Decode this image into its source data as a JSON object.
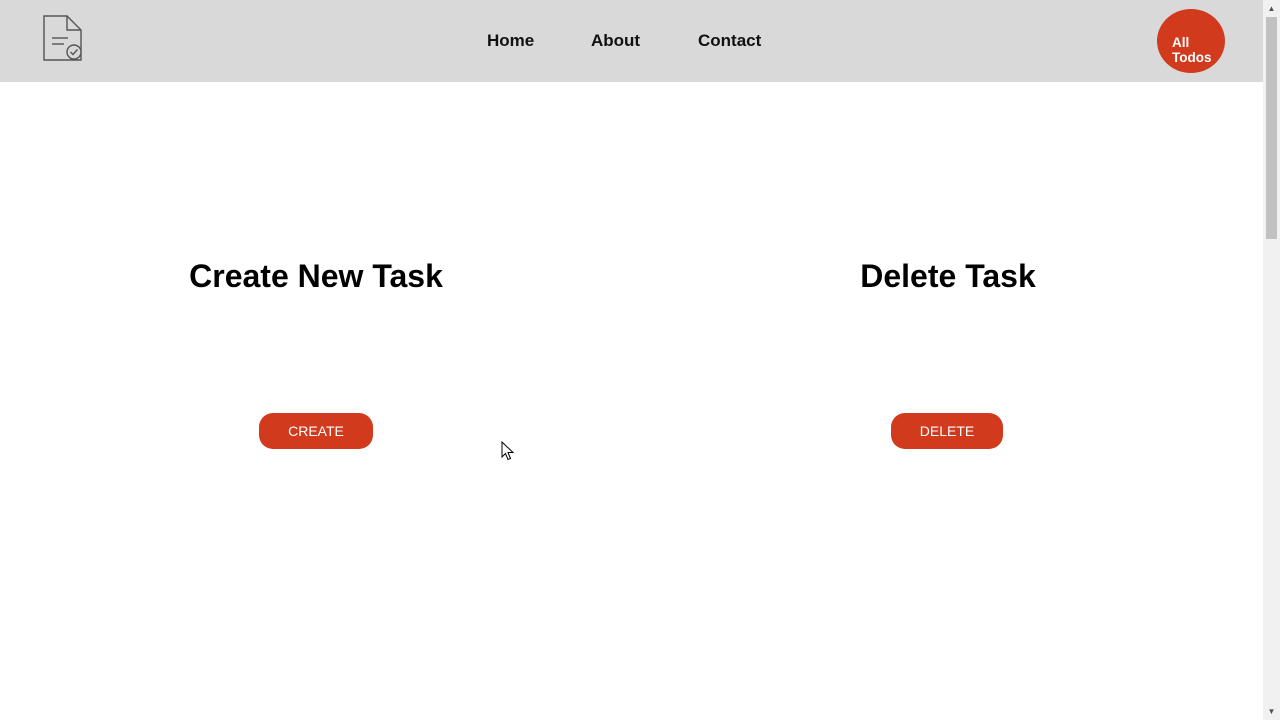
{
  "navbar": {
    "logo_icon": "document-check-icon",
    "links": [
      {
        "label": "Home"
      },
      {
        "label": "About"
      },
      {
        "label": "Contact"
      }
    ],
    "all_todos": {
      "line1": "All",
      "line2": "Todos"
    }
  },
  "panels": {
    "create": {
      "title": "Create New Task",
      "button_label": "CREATE"
    },
    "delete": {
      "title": "Delete Task",
      "button_label": "DELETE"
    }
  },
  "colors": {
    "accent": "#d13a1c",
    "navbar_bg": "#d9d9d9",
    "page_bg": "#ffffff"
  }
}
